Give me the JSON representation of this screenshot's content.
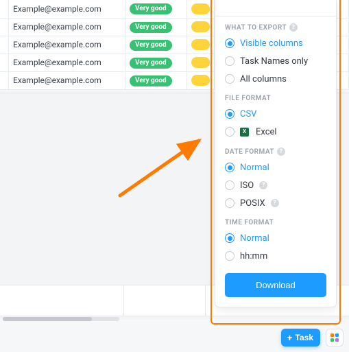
{
  "table": {
    "rows": [
      {
        "email": "Example@example.com",
        "rating": "Very good"
      },
      {
        "email": "Example@example.com",
        "rating": "Very good"
      },
      {
        "email": "Example@example.com",
        "rating": "Very good"
      },
      {
        "email": "Example@example.com",
        "rating": "Very good"
      },
      {
        "email": "Example@example.com",
        "rating": "Very good"
      }
    ]
  },
  "export": {
    "sections": {
      "what_to_export": {
        "label": "WHAT TO EXPORT",
        "options": {
          "visible_columns": "Visible columns",
          "task_names_only": "Task Names only",
          "all_columns": "All columns"
        },
        "selected": "visible_columns"
      },
      "file_format": {
        "label": "FILE FORMAT",
        "options": {
          "csv": "CSV",
          "excel": "Excel"
        },
        "selected": "csv"
      },
      "date_format": {
        "label": "DATE FORMAT",
        "options": {
          "normal": "Normal",
          "iso": "ISO",
          "posix": "POSIX"
        },
        "selected": "normal"
      },
      "time_format": {
        "label": "TIME FORMAT",
        "options": {
          "normal": "Normal",
          "hhmm": "hh:mm"
        },
        "selected": "normal"
      }
    },
    "download_label": "Download"
  },
  "footer": {
    "task_button": "Task"
  },
  "colors": {
    "accent": "#1e9bff",
    "arrow": "#ff7b00",
    "rating_pill": "#38c172",
    "yellow_bar": "#ffd43b"
  }
}
